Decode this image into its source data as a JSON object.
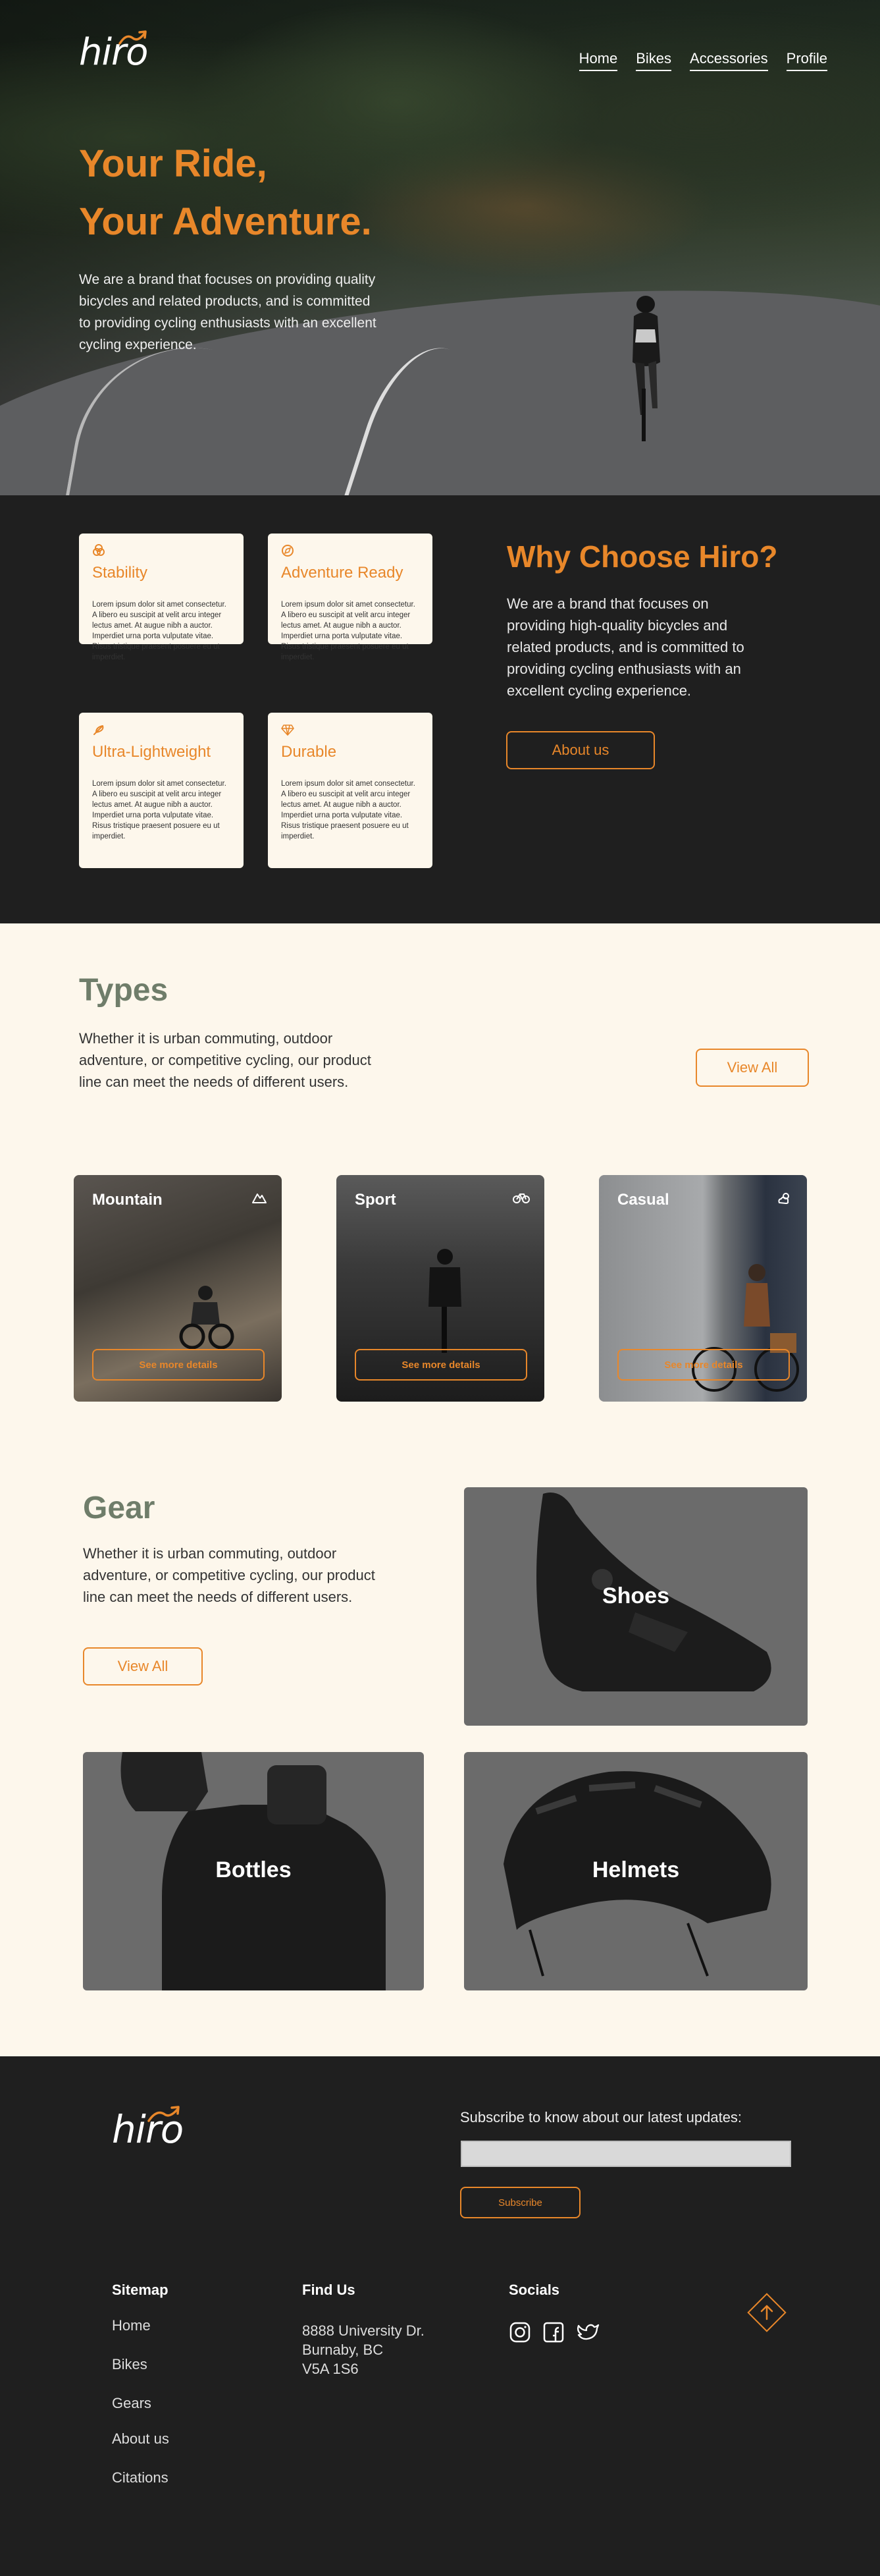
{
  "brand": {
    "logo": "hiro",
    "accent": "#e8872a",
    "sage": "#6f7d6a",
    "dark": "#1f1f1f",
    "cream": "#fdf7ec"
  },
  "nav": {
    "items": [
      "Home",
      "Bikes",
      "Accessories",
      "Profile"
    ]
  },
  "hero": {
    "title_line1": "Your Ride,",
    "title_line2": "Your Adventure.",
    "description": "We are a brand that focuses on providing quality bicycles and related products, and is committed to providing cycling enthusiasts with an excellent cycling experience."
  },
  "why": {
    "title": "Why Choose Hiro?",
    "description": "We are a brand that focuses on providing high-quality bicycles and related products, and is committed to providing cycling enthusiasts with an excellent cycling experience.",
    "button": "About us",
    "features": [
      {
        "icon": "link-rings-icon",
        "title": "Stability",
        "text": "Lorem ipsum dolor sit amet consectetur. A libero eu suscipit at velit arcu integer lectus amet. At augue nibh a auctor. Imperdiet urna porta vulputate vitae. Risus tristique praesent posuere eu ut imperdiet."
      },
      {
        "icon": "compass-icon",
        "title": "Adventure Ready",
        "text": "Lorem ipsum dolor sit amet consectetur. A libero eu suscipit at velit arcu integer lectus amet. At augue nibh a auctor. Imperdiet urna porta vulputate vitae. Risus tristique praesent posuere eu ut imperdiet."
      },
      {
        "icon": "feather-icon",
        "title": "Ultra-Lightweight",
        "text": "Lorem ipsum dolor sit amet consectetur. A libero eu suscipit at velit arcu integer lectus amet. At augue nibh a auctor. Imperdiet urna porta vulputate vitae. Risus tristique praesent posuere eu ut imperdiet."
      },
      {
        "icon": "diamond-icon",
        "title": "Durable",
        "text": "Lorem ipsum dolor sit amet consectetur. A libero eu suscipit at velit arcu integer lectus amet. At augue nibh a auctor. Imperdiet urna porta vulputate vitae. Risus tristique praesent posuere eu ut imperdiet."
      }
    ]
  },
  "types": {
    "title": "Types",
    "description": "Whether it is urban commuting, outdoor adventure, or competitive cycling, our product line can meet the needs  of different users.",
    "button": "View All",
    "cards": [
      {
        "name": "Mountain",
        "icon": "mountain-icon",
        "button": "See more details"
      },
      {
        "name": "Sport",
        "icon": "bicycle-icon",
        "button": "See more details"
      },
      {
        "name": "Casual",
        "icon": "sun-cloud-icon",
        "button": "See more details"
      }
    ]
  },
  "gear": {
    "title": "Gear",
    "description": "Whether it is urban commuting, outdoor adventure, or competitive cycling, our product line can meet the needs  of different users.",
    "button": "View All",
    "items": [
      "Shoes",
      "Bottles",
      "Helmets"
    ]
  },
  "footer": {
    "subscribe_text": "Subscribe to know about our latest updates:",
    "subscribe_button": "Subscribe",
    "sitemap_title": "Sitemap",
    "sitemap": [
      "Home",
      "Bikes",
      "Gears",
      "About us",
      "Citations"
    ],
    "findus_title": "Find Us",
    "address_line1": "8888 University Dr.",
    "address_line2": "Burnaby, BC",
    "address_line3": "V5A 1S6",
    "socials_title": "Socials",
    "socials": [
      "instagram-icon",
      "facebook-icon",
      "twitter-icon"
    ]
  }
}
